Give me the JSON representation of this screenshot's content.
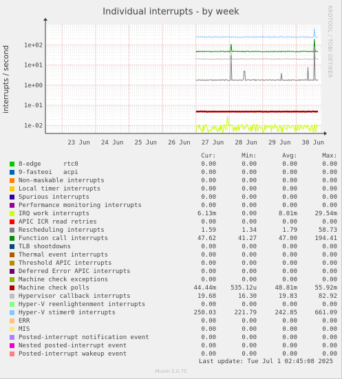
{
  "title": "Individual interrupts - by week",
  "side_label": "RRDTOOL / TOBI OETIKER",
  "footer": {
    "last_update": "Last update: Tue Jul  1 02:45:08 2025",
    "munin": "Munin 2.0.75"
  },
  "legend_headers": [
    "Cur:",
    "Min:",
    "Avg:",
    "Max:"
  ],
  "legend": [
    {
      "name": "8-edge      rtc0",
      "color": "#00cc00",
      "cur": "0.00",
      "min": "0.00",
      "avg": "0.00",
      "max": "0.00"
    },
    {
      "name": "9-fasteoi   acpi",
      "color": "#0066b3",
      "cur": "0.00",
      "min": "0.00",
      "avg": "0.00",
      "max": "0.00"
    },
    {
      "name": "Non-maskable interrupts",
      "color": "#ff8000",
      "cur": "0.00",
      "min": "0.00",
      "avg": "0.00",
      "max": "0.00"
    },
    {
      "name": "Local timer interrupts",
      "color": "#ffcc00",
      "cur": "0.00",
      "min": "0.00",
      "avg": "0.00",
      "max": "0.00"
    },
    {
      "name": "Spurious interrupts",
      "color": "#330099",
      "cur": "0.00",
      "min": "0.00",
      "avg": "0.00",
      "max": "0.00"
    },
    {
      "name": "Performance monitoring interrupts",
      "color": "#990099",
      "cur": "0.00",
      "min": "0.00",
      "avg": "0.00",
      "max": "0.00"
    },
    {
      "name": "IRQ work interrupts",
      "color": "#ccff00",
      "cur": "6.13m",
      "min": "0.00",
      "avg": "8.01m",
      "max": "29.54m"
    },
    {
      "name": "APIC ICR read retries",
      "color": "#ff0000",
      "cur": "0.00",
      "min": "0.00",
      "avg": "0.00",
      "max": "0.00"
    },
    {
      "name": "Rescheduling interrupts",
      "color": "#808080",
      "cur": "1.59",
      "min": "1.34",
      "avg": "1.79",
      "max": "58.73"
    },
    {
      "name": "Function call interrupts",
      "color": "#008f00",
      "cur": "47.62",
      "min": "41.27",
      "avg": "47.00",
      "max": "194.41"
    },
    {
      "name": "TLB shootdowns",
      "color": "#00487d",
      "cur": "0.00",
      "min": "0.00",
      "avg": "0.00",
      "max": "0.00"
    },
    {
      "name": "Thermal event interrupts",
      "color": "#b35a00",
      "cur": "0.00",
      "min": "0.00",
      "avg": "0.00",
      "max": "0.00"
    },
    {
      "name": "Threshold APIC interrupts",
      "color": "#b38f00",
      "cur": "0.00",
      "min": "0.00",
      "avg": "0.00",
      "max": "0.00"
    },
    {
      "name": "Deferred Error APIC interrupts",
      "color": "#6b006b",
      "cur": "0.00",
      "min": "0.00",
      "avg": "0.00",
      "max": "0.00"
    },
    {
      "name": "Machine check exceptions",
      "color": "#8fb300",
      "cur": "0.00",
      "min": "0.00",
      "avg": "0.00",
      "max": "0.00"
    },
    {
      "name": "Machine check polls",
      "color": "#b30000",
      "cur": "44.44m",
      "min": "535.12u",
      "avg": "48.81m",
      "max": "55.92m"
    },
    {
      "name": "Hypervisor callback interrupts",
      "color": "#bebebe",
      "cur": "19.68",
      "min": "16.30",
      "avg": "19.83",
      "max": "82.92"
    },
    {
      "name": "Hyper-V reenlightenment interrupts",
      "color": "#80ff80",
      "cur": "0.00",
      "min": "0.00",
      "avg": "0.00",
      "max": "0.00"
    },
    {
      "name": "Hyper-V stimer0 interrupts",
      "color": "#80c9ff",
      "cur": "258.03",
      "min": "221.79",
      "avg": "242.85",
      "max": "661.09"
    },
    {
      "name": "ERR",
      "color": "#ffc080",
      "cur": "0.00",
      "min": "0.00",
      "avg": "0.00",
      "max": "0.00"
    },
    {
      "name": "MIS",
      "color": "#ffe680",
      "cur": "0.00",
      "min": "0.00",
      "avg": "0.00",
      "max": "0.00"
    },
    {
      "name": "Posted-interrupt notification event",
      "color": "#aa80ff",
      "cur": "0.00",
      "min": "0.00",
      "avg": "0.00",
      "max": "0.00"
    },
    {
      "name": "Nested posted-interrupt event",
      "color": "#ee00cc",
      "cur": "0.00",
      "min": "0.00",
      "avg": "0.00",
      "max": "0.00"
    },
    {
      "name": "Posted-interrupt wakeup event",
      "color": "#ff8080",
      "cur": "0.00",
      "min": "0.00",
      "avg": "0.00",
      "max": "0.00"
    }
  ],
  "chart_data": {
    "type": "line",
    "title": "Individual interrupts - by week",
    "ylabel": "interrupts / second",
    "y_scale": "log",
    "ylim": [
      0.004,
      1000
    ],
    "y_ticks": [
      {
        "value": 100,
        "label": "1e+02"
      },
      {
        "value": 10,
        "label": "1e+01"
      },
      {
        "value": 1,
        "label": "1e+00"
      },
      {
        "value": 0.1,
        "label": "1e-01"
      },
      {
        "value": 0.01,
        "label": "1e-02"
      }
    ],
    "x_ticks": [
      "23 Jun",
      "24 Jun",
      "25 Jun",
      "26 Jun",
      "27 Jun",
      "28 Jun",
      "29 Jun",
      "30 Jun"
    ],
    "x_range_days": [
      22.5,
      30.75
    ],
    "grid": true,
    "data_start_day": 27.0,
    "series": [
      {
        "name": "Hyper-V stimer0 interrupts",
        "color": "#80c9ff",
        "base": 245,
        "spikes": [
          {
            "day": 30.55,
            "value": 661.09
          }
        ]
      },
      {
        "name": "Function call interrupts",
        "color": "#008f00",
        "base": 47,
        "spikes": [
          {
            "day": 28.05,
            "value": 110
          },
          {
            "day": 30.55,
            "value": 194.41
          }
        ]
      },
      {
        "name": "Hypervisor callback interrupts",
        "color": "#bebebe",
        "base": 19.8,
        "spikes": [
          {
            "day": 28.05,
            "value": 45
          },
          {
            "day": 30.55,
            "value": 82.92
          }
        ]
      },
      {
        "name": "Rescheduling interrupts",
        "color": "#808080",
        "base": 1.79,
        "spikes": [
          {
            "day": 28.05,
            "value": 30
          },
          {
            "day": 28.45,
            "value": 5
          },
          {
            "day": 29.55,
            "value": 4
          },
          {
            "day": 30.35,
            "value": 8
          },
          {
            "day": 30.55,
            "value": 58.73
          }
        ]
      },
      {
        "name": "Machine check polls",
        "color": "#b30000",
        "base": 0.0488,
        "spikes": []
      },
      {
        "name": "IRQ work interrupts",
        "color": "#ccff00",
        "base": 0.008,
        "spikes": [
          {
            "day": 27.95,
            "value": 0.0295
          }
        ]
      }
    ]
  }
}
